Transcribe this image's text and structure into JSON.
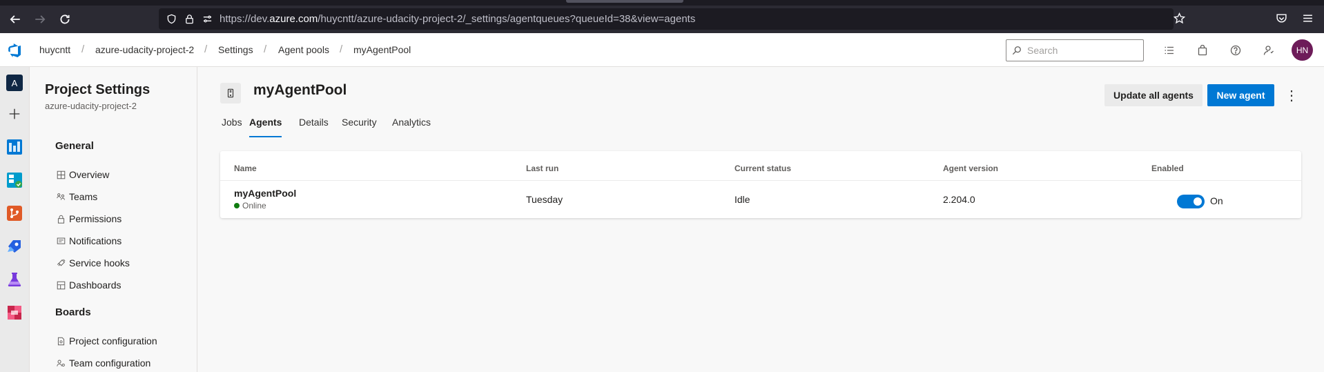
{
  "browser": {
    "url_prefix": "https://dev.",
    "url_host": "azure.com",
    "url_path": "/huycntt/azure-udacity-project-2/_settings/agentqueues?queueId=38&view=agents"
  },
  "header": {
    "breadcrumbs": [
      "huycntt",
      "azure-udacity-project-2",
      "Settings",
      "Agent pools",
      "myAgentPool"
    ],
    "separator": "/",
    "search_placeholder": "Search",
    "avatar_initials": "HN"
  },
  "rail": {
    "project_letter": "A"
  },
  "settings_nav": {
    "title": "Project Settings",
    "subtitle": "azure-udacity-project-2",
    "general_heading": "General",
    "general_items": [
      "Overview",
      "Teams",
      "Permissions",
      "Notifications",
      "Service hooks",
      "Dashboards"
    ],
    "boards_heading": "Boards",
    "boards_items": [
      "Project configuration",
      "Team configuration"
    ]
  },
  "main": {
    "pool_title": "myAgentPool",
    "update_button": "Update all agents",
    "new_agent_button": "New agent",
    "more_label": "⋮",
    "tabs": [
      "Jobs",
      "Agents",
      "Details",
      "Security",
      "Analytics"
    ],
    "active_tab": "Agents",
    "table": {
      "columns": [
        "Name",
        "Last run",
        "Current status",
        "Agent version",
        "Enabled"
      ],
      "rows": [
        {
          "name": "myAgentPool",
          "status": "Online",
          "last_run": "Tuesday",
          "current_status": "Idle",
          "agent_version": "2.204.0",
          "enabled": true,
          "enabled_label": "On"
        }
      ]
    }
  },
  "colors": {
    "accent": "#0078d4",
    "online": "#107c10",
    "avatar": "#6d1c59"
  }
}
